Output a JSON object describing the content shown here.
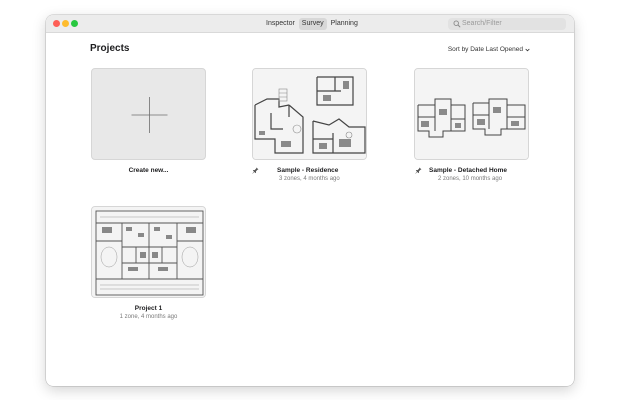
{
  "toolbar": {
    "tabs": [
      {
        "label": "Inspector",
        "active": false
      },
      {
        "label": "Survey",
        "active": true
      },
      {
        "label": "Planning",
        "active": false
      }
    ],
    "search_placeholder": "Search/Filter"
  },
  "page": {
    "title": "Projects",
    "sort_label": "Sort by Date Last Opened"
  },
  "projects": [
    {
      "title": "Create new...",
      "subtitle": ""
    },
    {
      "title": "Sample - Residence",
      "subtitle": "3 zones, 4 months ago",
      "pinned": true
    },
    {
      "title": "Sample - Detached Home",
      "subtitle": "2 zones, 10 months ago",
      "pinned": true
    },
    {
      "title": "Project 1",
      "subtitle": "1 zone, 4 months ago",
      "pinned": false
    }
  ],
  "icons": {
    "search": "search-icon",
    "sort_chevron": "chevron-down-icon",
    "pin": "pin-icon",
    "plus": "plus-icon"
  },
  "colors": {
    "close": "#fe5f57",
    "minimize": "#febc2e",
    "maximize": "#28c840",
    "create_tile": "#e8e8e8"
  }
}
